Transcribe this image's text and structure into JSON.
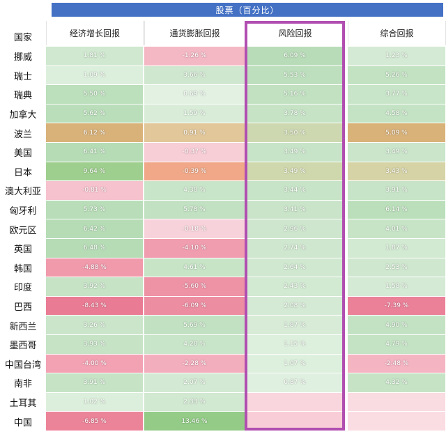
{
  "banner": "股票（百分比）",
  "header": {
    "country": "国家",
    "columns": [
      "经济增长回报",
      "通货膨胀回报",
      "风险回报",
      "综合回报"
    ]
  },
  "rows": [
    {
      "country": "挪威",
      "values": [
        "1.81 %",
        "-1.26 %",
        "6.09 %",
        "1.23 %"
      ],
      "colors": [
        "#cfe8cf",
        "#f4b8c4",
        "#b8dcb8",
        "#d4ead4"
      ]
    },
    {
      "country": "瑞士",
      "values": [
        "1.09 %",
        "3.66 %",
        "5.53 %",
        "5.26 %"
      ],
      "colors": [
        "#dcefdc",
        "#cfe7cf",
        "#bddfbd",
        "#c2e2c2"
      ]
    },
    {
      "country": "瑞典",
      "values": [
        "5.50 %",
        "0.69 %",
        "5.16 %",
        "3.77 %"
      ],
      "colors": [
        "#bcdfbc",
        "#e2f1e2",
        "#c1e1c1",
        "#c9e5c9"
      ]
    },
    {
      "country": "加拿大",
      "values": [
        "5.62 %",
        "1.59 %",
        "3.78 %",
        "4.58 %"
      ],
      "colors": [
        "#badeba",
        "#d8ecd8",
        "#c6e3c6",
        "#c4e3c4"
      ]
    },
    {
      "country": "波兰",
      "values": [
        "6.12 %",
        "0.91 %",
        "3.50 %",
        "5.09 %"
      ],
      "colors": [
        "#d9b27a",
        "#e1c79a",
        "#cdd8b0",
        "#d9b27a"
      ]
    },
    {
      "country": "美国",
      "values": [
        "6.41 %",
        "-0.37 %",
        "3.49 %",
        "3.49 %"
      ],
      "colors": [
        "#b6dcb6",
        "#f7cdd6",
        "#c8e4c8",
        "#cae5ca"
      ]
    },
    {
      "country": "日本",
      "values": [
        "9.64 %",
        "-0.39 %",
        "3.49 %",
        "3.43 %"
      ],
      "colors": [
        "#9fcf8f",
        "#f0a888",
        "#cfd8ad",
        "#d6d3a6"
      ]
    },
    {
      "country": "澳大利亚",
      "values": [
        "-0.81 %",
        "4.38 %",
        "3.44 %",
        "3.91 %"
      ],
      "colors": [
        "#f6c2cd",
        "#c9e5c9",
        "#c8e4c8",
        "#c8e4c8"
      ]
    },
    {
      "country": "匈牙利",
      "values": [
        "5.73 %",
        "5.78 %",
        "3.41 %",
        "6.14 %"
      ],
      "colors": [
        "#b9ddb9",
        "#c2e1c2",
        "#c9e4c9",
        "#bbdfbb"
      ]
    },
    {
      "country": "欧元区",
      "values": [
        "6.42 %",
        "-0.18 %",
        "2.96 %",
        "4.01 %"
      ],
      "colors": [
        "#b6dcb6",
        "#f7d2da",
        "#cde6cd",
        "#c7e4c7"
      ]
    },
    {
      "country": "英国",
      "values": [
        "6.48 %",
        "-4.10 %",
        "2.74 %",
        "1.87 %"
      ],
      "colors": [
        "#b6dcb6",
        "#f09daf",
        "#cfe7cf",
        "#d2e9d2"
      ]
    },
    {
      "country": "韩国",
      "values": [
        "-4.88 %",
        "4.61 %",
        "2.64 %",
        "2.53 %"
      ],
      "colors": [
        "#f09aac",
        "#c7e4c7",
        "#d0e8d0",
        "#cfe7cf"
      ]
    },
    {
      "country": "印度",
      "values": [
        "3.92 %",
        "-5.60 %",
        "2.43 %",
        "1.58 %"
      ],
      "colors": [
        "#c6e3c6",
        "#ee92a6",
        "#d2e9d2",
        "#d5ead5"
      ]
    },
    {
      "country": "巴西",
      "values": [
        "-8.43 %",
        "-6.09 %",
        "2.08 %",
        "-7.39 %"
      ],
      "colors": [
        "#ea7b94",
        "#ed8da2",
        "#d5ead5",
        "#eb8099"
      ]
    },
    {
      "country": "新西兰",
      "values": [
        "3.26 %",
        "5.69 %",
        "1.87 %",
        "4.90 %"
      ],
      "colors": [
        "#cae5ca",
        "#c2e1c2",
        "#d7ebd7",
        "#c3e2c3"
      ]
    },
    {
      "country": "墨西哥",
      "values": [
        "3.93 %",
        "4.28 %",
        "1.15 %",
        "4.79 %"
      ],
      "colors": [
        "#c6e3c6",
        "#c9e5c9",
        "#ddefdd",
        "#c4e3c4"
      ]
    },
    {
      "country": "中国台湾",
      "values": [
        "-4.00 %",
        "-2.28 %",
        "1.07 %",
        "-2.48 %"
      ],
      "colors": [
        "#f2a2b3",
        "#f3aebd",
        "#ddefdd",
        "#f4b4c2"
      ]
    },
    {
      "country": "南非",
      "values": [
        "3.91 %",
        "2.07 %",
        "0.87 %",
        "4.32 %"
      ],
      "colors": [
        "#c6e3c6",
        "#d3e9d3",
        "#e0f0e0",
        "#c6e3c6"
      ]
    },
    {
      "country": "土耳其",
      "values": [
        "1.02 %",
        "2.33 %",
        "",
        ""
      ],
      "colors": [
        "#dcefdc",
        "#d1e8d1",
        "#f9d6de",
        "#f9dbe2"
      ]
    },
    {
      "country": "中国",
      "values": [
        "-6.85 %",
        "13.46 %",
        "",
        ""
      ],
      "colors": [
        "#ec8499",
        "#93cb87",
        "#f8cdd7",
        "#fadce3"
      ]
    }
  ]
}
